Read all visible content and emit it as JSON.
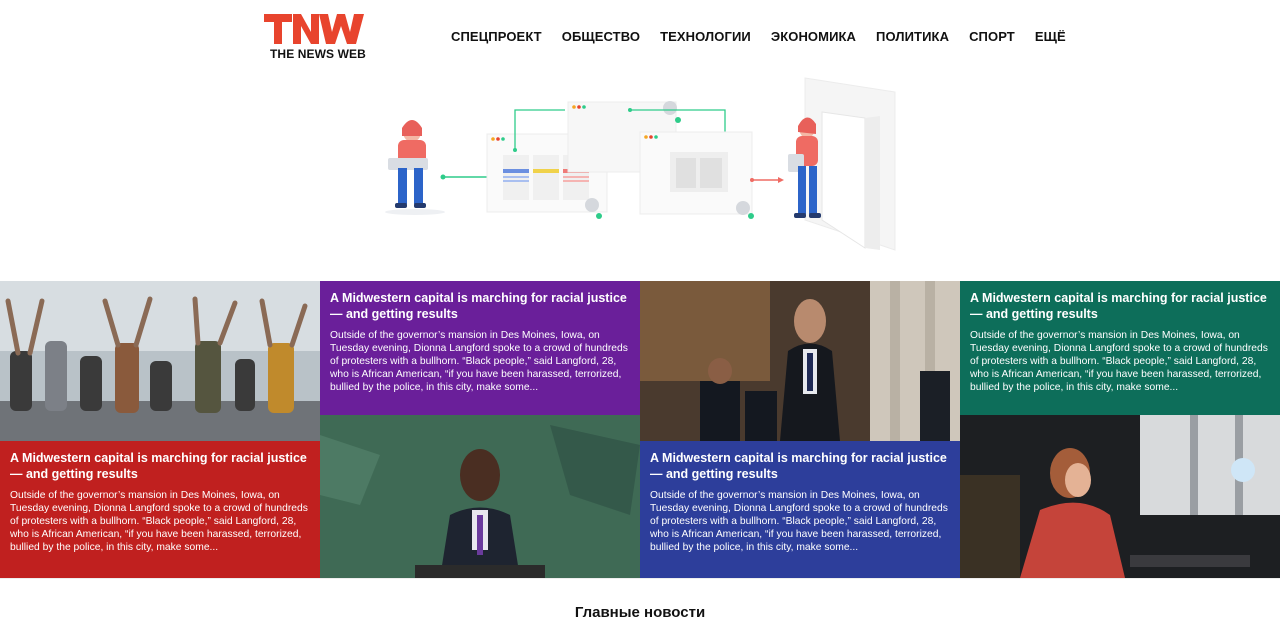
{
  "brand": {
    "logo_text": "TNW",
    "logo_subtitle": "THE NEWS WEB",
    "accent": "#e8442d"
  },
  "nav": {
    "items": [
      "СПЕЦПРОЕКТ",
      "ОБЩЕСТВО",
      "ТЕХНОЛОГИИ",
      "ЭКОНОМИКА",
      "ПОЛИТИКА",
      "СПОРТ",
      "ЕЩЁ"
    ]
  },
  "cards": [
    {
      "title": "A Midwestern capital is marching for racial justice — and getting results",
      "excerpt": "Outside of the governor’s mansion in Des Moines, Iowa, on Tuesday evening, Dionna Langford spoke to a crowd of hundreds of protesters with a bullhorn. “Black people,” said Langford, 28, who is African American, “if you have been harassed, terrorized, bullied by the police, in this city, make some...",
      "color": "#c0201f"
    },
    {
      "title": "A Midwestern capital is marching for racial justice — and getting results",
      "excerpt": "Outside of the governor’s mansion in Des Moines, Iowa, on Tuesday evening, Dionna Langford spoke to a crowd of hundreds of protesters with a bullhorn. “Black people,” said Langford, 28, who is African American, “if you have been harassed, terrorized, bullied by the police, in this city, make some...",
      "color": "#6a1f9a"
    },
    {
      "title": "A Midwestern capital is marching for racial justice — and getting results",
      "excerpt": "Outside of the governor’s mansion in Des Moines, Iowa, on Tuesday evening, Dionna Langford spoke to a crowd of hundreds of protesters with a bullhorn. “Black people,” said Langford, 28, who is African American, “if you have been harassed, terrorized, bullied by the police, in this city, make some...",
      "color": "#2d3e9b"
    },
    {
      "title": "A Midwestern capital is marching for racial justice — and getting results",
      "excerpt": "Outside of the governor’s mansion in Des Moines, Iowa, on Tuesday evening, Dionna Langford spoke to a crowd of hundreds of protesters with a bullhorn. “Black people,” said Langford, 28, who is African American, “if you have been harassed, terrorized, bullied by the police, in this city, make some...",
      "color": "#0d6e5a"
    }
  ],
  "photos": [
    "protest-crowd-photo",
    "speaker-at-podium-photo",
    "officials-in-hall-photo",
    "woman-at-computer-photo"
  ],
  "main_news": {
    "title": "Главные новости"
  }
}
